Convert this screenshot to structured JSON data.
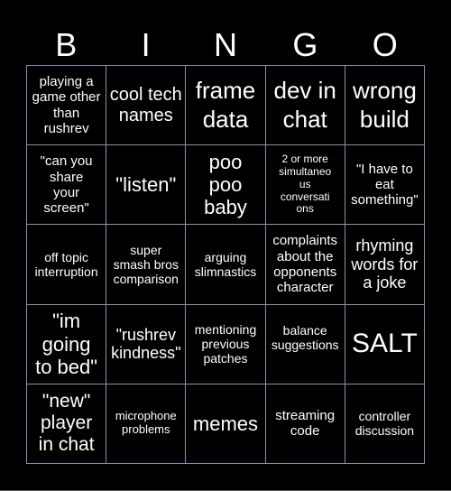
{
  "header": {
    "letters": [
      "B",
      "I",
      "N",
      "G",
      "O"
    ]
  },
  "cells": [
    {
      "text": "playing a game other than rushrev"
    },
    {
      "text": "cool tech names"
    },
    {
      "text": "frame data"
    },
    {
      "text": "dev in chat"
    },
    {
      "text": "wrong build"
    },
    {
      "text": "\"can you share your screen\""
    },
    {
      "text": "\"listen\""
    },
    {
      "text": "poo poo baby"
    },
    {
      "text": "2 or more simultaneous conversations"
    },
    {
      "text": "\"I have to eat something\""
    },
    {
      "text": "off topic interruption"
    },
    {
      "text": "super smash bros comparison"
    },
    {
      "text": "arguing slimnastics"
    },
    {
      "text": "complaints about the opponents character"
    },
    {
      "text": "rhyming words for a joke"
    },
    {
      "text": "\"im going to bed\""
    },
    {
      "text": "\"rushrev kindness\""
    },
    {
      "text": "mentioning previous patches"
    },
    {
      "text": "balance suggestions"
    },
    {
      "text": "SALT"
    },
    {
      "text": "\"new\" player in chat"
    },
    {
      "text": "microphone problems"
    },
    {
      "text": "memes"
    },
    {
      "text": "streaming code"
    },
    {
      "text": "controller discussion"
    }
  ],
  "colors": {
    "background": "#000000",
    "grid_line": "#8a90b0",
    "text": "#ffffff"
  }
}
